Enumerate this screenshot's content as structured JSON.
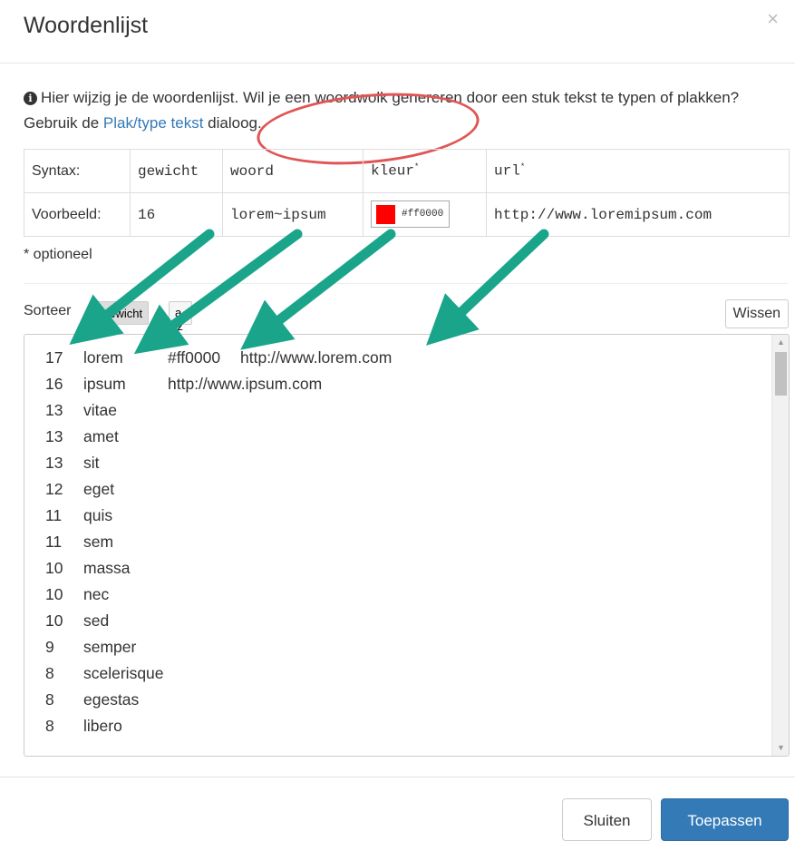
{
  "dialog": {
    "title": "Woordenlijst",
    "close_symbol": "×"
  },
  "intro": {
    "icon": "info-circle-icon",
    "text_before": "Hier wijzig je de woordenlijst. Wil je een woordwolk genereren door een stuk tekst te typen of plakken? Gebruik de ",
    "link_text": "Plak/type tekst",
    "text_after": " dialoog."
  },
  "syntax_table": {
    "row_syntax": {
      "label": "Syntax:",
      "weight": "gewicht",
      "word": "woord",
      "color": "kleur",
      "url": "url",
      "optional_marker": "*"
    },
    "row_example": {
      "label": "Voorbeeld:",
      "weight": "16",
      "word": "lorem~ipsum",
      "color_value": "#ff0000",
      "swatch_color": "#ff0000",
      "url": "http://www.loremipsum.com"
    }
  },
  "optional_note": "* optioneel",
  "sort": {
    "label": "Sorteer",
    "options": [
      "gewicht",
      "a-z"
    ],
    "active": "gewicht"
  },
  "clear_button": "Wissen",
  "word_list": [
    {
      "weight": "17",
      "text": "lorem",
      "color": "#ff0000",
      "url": "http://www.lorem.com"
    },
    {
      "weight": "16",
      "text": "ipsum",
      "url": "http://www.ipsum.com"
    },
    {
      "weight": "13",
      "text": "vitae"
    },
    {
      "weight": "13",
      "text": "amet"
    },
    {
      "weight": "13",
      "text": "sit"
    },
    {
      "weight": "12",
      "text": "eget"
    },
    {
      "weight": "11",
      "text": "quis"
    },
    {
      "weight": "11",
      "text": "sem"
    },
    {
      "weight": "10",
      "text": "massa"
    },
    {
      "weight": "10",
      "text": "nec"
    },
    {
      "weight": "10",
      "text": "sed"
    },
    {
      "weight": "9",
      "text": "semper"
    },
    {
      "weight": "8",
      "text": "scelerisque"
    },
    {
      "weight": "8",
      "text": "egestas"
    },
    {
      "weight": "8",
      "text": "libero"
    }
  ],
  "footer": {
    "close_label": "Sluiten",
    "apply_label": "Toepassen"
  },
  "colors": {
    "primary": "#337ab7",
    "annotation_oval": "#e05555",
    "annotation_arrow": "#1aa58a"
  }
}
